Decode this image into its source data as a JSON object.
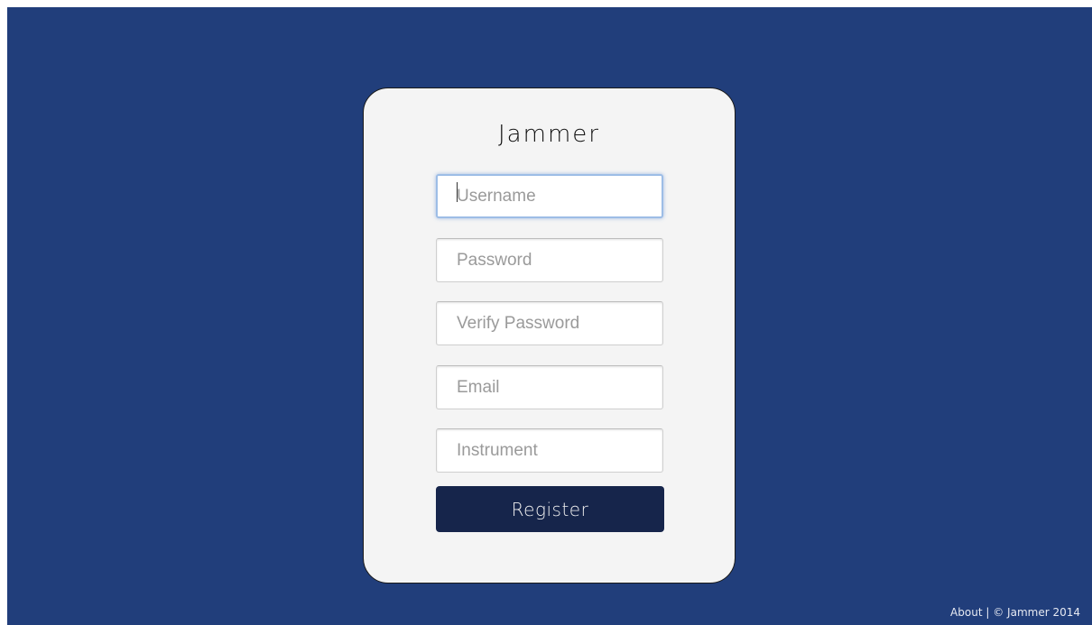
{
  "app": {
    "brand": "Jammer"
  },
  "form": {
    "username_placeholder": "Username",
    "password_placeholder": "Password",
    "verify_password_placeholder": "Verify Password",
    "email_placeholder": "Email",
    "instrument_placeholder": "Instrument",
    "register_label": "Register"
  },
  "footer": {
    "about_label": "About",
    "separator": "|",
    "copyright": "© Jammer 2014"
  },
  "colors": {
    "background": "#213e7b",
    "card": "#f4f4f4",
    "button": "#16254b",
    "focus_ring": "#9dbde6"
  }
}
